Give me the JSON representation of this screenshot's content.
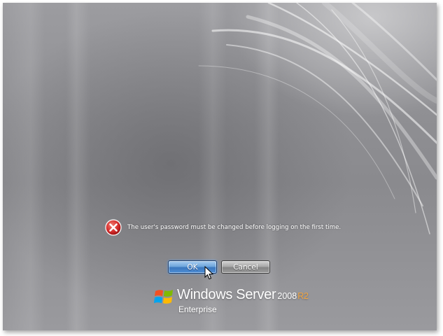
{
  "dialog": {
    "message": "The user's password must be changed before logging on the first time.",
    "ok_label": "OK",
    "cancel_label": "Cancel"
  },
  "icons": {
    "error": "error-icon",
    "cursor": "mouse-pointer-icon",
    "logo": "windows-flag-icon"
  },
  "branding": {
    "product": "Windows Server",
    "version": "2008",
    "release": "R2",
    "edition": "Enterprise"
  },
  "colors": {
    "error_red": "#d42a2a",
    "ok_button_blue": "#4f8fd6",
    "r2_accent": "#f2a541",
    "background_gray": "#8f8f93"
  }
}
